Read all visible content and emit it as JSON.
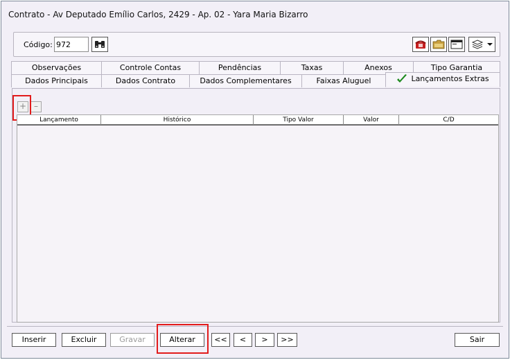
{
  "window": {
    "title": "Contrato - Av Deputado Emílio Carlos, 2429 - Ap. 02 - Yara Maria Bizarro"
  },
  "code_section": {
    "label": "Código:",
    "value": "972"
  },
  "toolbar_icons": [
    "binoculars-icon",
    "phone-icon",
    "folder-icon",
    "window-icon",
    "layers-icon",
    "chevron-down-icon"
  ],
  "tabs_row1": [
    "Observações",
    "Controle Contas",
    "Pendências",
    "Taxas",
    "Anexos",
    "Tipo Garantia"
  ],
  "tabs_row2": [
    "Dados Principais",
    "Dados Contrato",
    "Dados Complementares",
    "Faixas Aluguel",
    "Lançamentos Extras"
  ],
  "active_tab": "Lançamentos Extras",
  "grid": {
    "add_label": "+",
    "remove_label": "–",
    "columns": [
      "Lançamento",
      "Histórico",
      "Tipo Valor",
      "Valor",
      "C/D"
    ],
    "rows": []
  },
  "buttons": {
    "inserir": "Inserir",
    "excluir": "Excluir",
    "gravar": "Gravar",
    "alterar": "Alterar",
    "first": "<<",
    "prev": "<",
    "next": ">",
    "last": ">>",
    "sair": "Sair"
  },
  "colors": {
    "highlight": "#e21b1b",
    "check": "#1d8a1d"
  }
}
